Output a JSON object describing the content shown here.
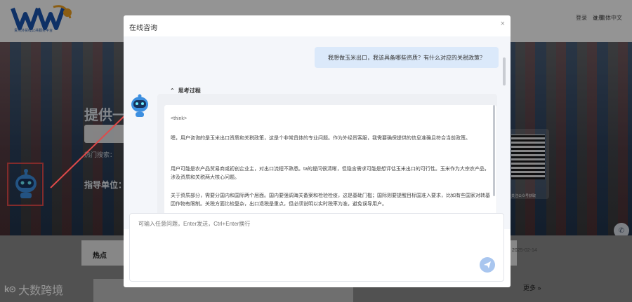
{
  "background": {
    "logo_caption": "贵州外贸线公共服务平台",
    "links": [
      "登录",
      "注册"
    ],
    "language": "简体中文",
    "hero_title": "提供一",
    "hero_hot": "热门搜索：",
    "hero_guide": "指导单位：",
    "hot_label": "热点",
    "date": "2025-02-14",
    "more": "更多 »",
    "qr_caption": "关注公众号获取"
  },
  "watermark": {
    "logo": "k⊙",
    "text": "大数跨境"
  },
  "modal": {
    "title": "在线咨询",
    "close_symbol": "×",
    "user_message": "我想做玉米出口，我该具备哪些资质？有什么对应的关税政策？",
    "thinking_label": "思考过程",
    "think_tag": "<think>",
    "paragraphs": [
      "嗯，用户咨询的是玉米出口资质和关税政策，这是个非常具体的专业问题。作为外经贸客服，我需要确保提供的信息准确且符合当前政策。",
      "用户可能是农产品贸易商或初创企业主，对出口流程不熟悉。ta的提问很清晰，但隐含需求可能是想评估玉米出口的可行性。玉米作为大宗农产品，涉及资质和关税两大核心问题。",
      "关于资质部分，需要分国内和国际两个层面。国内要强调海关备案和检验检疫，这是基础门槛；国际则要提醒目标国准入要求，比如有些国家对转基因作物有限制。关税方面比较复杂，出口退税是重点，但必须说明以实时税率为准，避免误导用户。"
    ],
    "input_placeholder": "可输入任意问题，Enter发送，Ctrl+Enter换行"
  },
  "colors": {
    "accent": "#dbe9fa",
    "annotation_red": "#e04a4a",
    "send": "#a9c6ef"
  }
}
